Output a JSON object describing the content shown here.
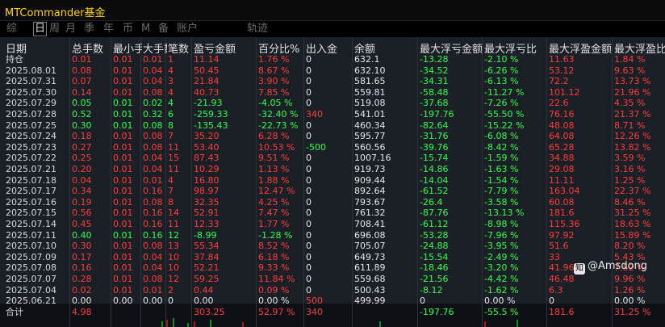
{
  "app": {
    "title": "MTCommander基金"
  },
  "tabs": [
    {
      "label": "综",
      "active": false
    },
    {
      "label": "日",
      "active": true
    },
    {
      "label": "周",
      "active": false
    },
    {
      "label": "月",
      "active": false
    },
    {
      "label": "季",
      "active": false
    },
    {
      "label": "年",
      "active": false
    },
    {
      "label": "币",
      "active": false
    },
    {
      "label": "M",
      "active": false
    },
    {
      "label": "备",
      "active": false
    },
    {
      "label": "账户",
      "active": false
    },
    {
      "label": "轨迹",
      "active": false
    }
  ],
  "table": {
    "headers": [
      "日期",
      "总手数",
      "最小手",
      "大手数",
      "笔数",
      "盈亏金额",
      "百分比%",
      "出入金",
      "余额",
      "最大浮亏金额",
      "最大浮亏比",
      "最大浮盈金额",
      "最大浮盈比"
    ],
    "rows": [
      {
        "date": "持仓",
        "lots": "0.01",
        "min": "0.01",
        "max": "0.01",
        "count": "1",
        "pnl": "11.14",
        "pct": "1.76 %",
        "io": "0",
        "bal": "632.1",
        "mfa": "-13.28",
        "mfp": "-2.10 %",
        "mga": "11.63",
        "mgp": "1.84 %",
        "c": "r",
        "ioc": "w"
      },
      {
        "date": "2025.08.01",
        "lots": "0.08",
        "min": "0.01",
        "max": "0.04",
        "count": "4",
        "pnl": "50.45",
        "pct": "8.67 %",
        "io": "0",
        "bal": "632.10",
        "mfa": "-34.52",
        "mfp": "-6.26 %",
        "mga": "53.12",
        "mgp": "9.63 %",
        "c": "r",
        "ioc": "w"
      },
      {
        "date": "2025.07.31",
        "lots": "0.07",
        "min": "0.01",
        "max": "0.04",
        "count": "3",
        "pnl": "21.84",
        "pct": "3.90 %",
        "io": "0",
        "bal": "581.65",
        "mfa": "-34.31",
        "mfp": "-6.13 %",
        "mga": "72.2",
        "mgp": "13.73 %",
        "c": "r",
        "ioc": "w"
      },
      {
        "date": "2025.07.30",
        "lots": "0.14",
        "min": "0.01",
        "max": "0.08",
        "count": "4",
        "pnl": "40.73",
        "pct": "7.85 %",
        "io": "0",
        "bal": "559.81",
        "mfa": "-58.48",
        "mfp": "-11.27 %",
        "mga": "101.12",
        "mgp": "21.96 %",
        "c": "r",
        "ioc": "w"
      },
      {
        "date": "2025.07.29",
        "lots": "0.05",
        "min": "0.01",
        "max": "0.02",
        "count": "4",
        "pnl": "-21.93",
        "pct": "-4.05 %",
        "io": "0",
        "bal": "519.08",
        "mfa": "-37.68",
        "mfp": "-7.26 %",
        "mga": "22.6",
        "mgp": "4.35 %",
        "c": "g",
        "ioc": "w"
      },
      {
        "date": "2025.07.28",
        "lots": "0.52",
        "min": "0.01",
        "max": "0.32",
        "count": "6",
        "pnl": "-259.33",
        "pct": "-32.40 %",
        "io": "340",
        "bal": "541.01",
        "mfa": "-197.76",
        "mfp": "-55.50 %",
        "mga": "76.16",
        "mgp": "21.37 %",
        "c": "g",
        "ioc": "r"
      },
      {
        "date": "2025.07.25",
        "lots": "0.30",
        "min": "0.01",
        "max": "0.08",
        "count": "8",
        "pnl": "-135.43",
        "pct": "-22.73 %",
        "io": "0",
        "bal": "460.34",
        "mfa": "-82.64",
        "mfp": "-15.22 %",
        "mga": "48.08",
        "mgp": "8.71 %",
        "c": "g",
        "ioc": "w"
      },
      {
        "date": "2025.07.24",
        "lots": "0.18",
        "min": "0.01",
        "max": "0.08",
        "count": "7",
        "pnl": "35.20",
        "pct": "6.28 %",
        "io": "0",
        "bal": "595.77",
        "mfa": "-31.76",
        "mfp": "-6.08 %",
        "mga": "64.08",
        "mgp": "12.26 %",
        "c": "r",
        "ioc": "w"
      },
      {
        "date": "2025.07.23",
        "lots": "0.27",
        "min": "0.01",
        "max": "0.08",
        "count": "11",
        "pnl": "53.40",
        "pct": "10.53 %",
        "io": "-500",
        "bal": "560.56",
        "mfa": "-39.76",
        "mfp": "-8.42 %",
        "mga": "65.28",
        "mgp": "13.82 %",
        "c": "r",
        "ioc": "g"
      },
      {
        "date": "2025.07.22",
        "lots": "0.25",
        "min": "0.01",
        "max": "0.04",
        "count": "15",
        "pnl": "87.43",
        "pct": "9.51 %",
        "io": "0",
        "bal": "1007.16",
        "mfa": "-15.74",
        "mfp": "-1.59 %",
        "mga": "34.88",
        "mgp": "3.59 %",
        "c": "r",
        "ioc": "w"
      },
      {
        "date": "2025.07.21",
        "lots": "0.20",
        "min": "0.01",
        "max": "0.04",
        "count": "11",
        "pnl": "10.29",
        "pct": "1.13 %",
        "io": "0",
        "bal": "919.73",
        "mfa": "-14.86",
        "mfp": "-1.63 %",
        "mga": "29.08",
        "mgp": "3.16 %",
        "c": "r",
        "ioc": "w"
      },
      {
        "date": "2025.07.18",
        "lots": "0.04",
        "min": "0.01",
        "max": "0.01",
        "count": "4",
        "pnl": "16.80",
        "pct": "1.88 %",
        "io": "0",
        "bal": "909.44",
        "mfa": "-14.04",
        "mfp": "-1.54 %",
        "mga": "11.11",
        "mgp": "1.25 %",
        "c": "r",
        "ioc": "w"
      },
      {
        "date": "2025.07.17",
        "lots": "0.34",
        "min": "0.01",
        "max": "0.16",
        "count": "7",
        "pnl": "98.97",
        "pct": "12.47 %",
        "io": "0",
        "bal": "892.64",
        "mfa": "-61.52",
        "mfp": "-7.79 %",
        "mga": "163.04",
        "mgp": "22.37 %",
        "c": "r",
        "ioc": "w"
      },
      {
        "date": "2025.07.16",
        "lots": "0.19",
        "min": "0.01",
        "max": "0.08",
        "count": "8",
        "pnl": "32.35",
        "pct": "4.25 %",
        "io": "0",
        "bal": "793.67",
        "mfa": "-26.4",
        "mfp": "-3.58 %",
        "mga": "60.08",
        "mgp": "8.46 %",
        "c": "r",
        "ioc": "w"
      },
      {
        "date": "2025.07.15",
        "lots": "0.56",
        "min": "0.01",
        "max": "0.16",
        "count": "14",
        "pnl": "52.91",
        "pct": "7.47 %",
        "io": "0",
        "bal": "761.32",
        "mfa": "-87.76",
        "mfp": "-13.13 %",
        "mga": "181.6",
        "mgp": "31.25 %",
        "c": "r",
        "ioc": "w"
      },
      {
        "date": "2025.07.14",
        "lots": "0.45",
        "min": "0.01",
        "max": "0.16",
        "count": "11",
        "pnl": "12.33",
        "pct": "1.77 %",
        "io": "0",
        "bal": "708.41",
        "mfa": "-61.12",
        "mfp": "-8.98 %",
        "mga": "115.36",
        "mgp": "18.63 %",
        "c": "r",
        "ioc": "w"
      },
      {
        "date": "2025.07.11",
        "lots": "0.40",
        "min": "0.01",
        "max": "0.16",
        "count": "12",
        "pnl": "-8.99",
        "pct": "-1.28 %",
        "io": "0",
        "bal": "696.08",
        "mfa": "-53.28",
        "mfp": "-7.96 %",
        "mga": "97.92",
        "mgp": "15.89 %",
        "c": "g",
        "ioc": "w"
      },
      {
        "date": "2025.07.10",
        "lots": "0.30",
        "min": "0.01",
        "max": "0.08",
        "count": "13",
        "pnl": "55.34",
        "pct": "8.52 %",
        "io": "0",
        "bal": "705.07",
        "mfa": "-24.88",
        "mfp": "-3.95 %",
        "mga": "51.6",
        "mgp": "8.20 %",
        "c": "r",
        "ioc": "w"
      },
      {
        "date": "2025.07.09",
        "lots": "0.17",
        "min": "0.01",
        "max": "0.04",
        "count": "10",
        "pnl": "37.84",
        "pct": "6.18 %",
        "io": "0",
        "bal": "649.73",
        "mfa": "-15.54",
        "mfp": "-2.49 %",
        "mga": "33",
        "mgp": "5.43 %",
        "c": "r",
        "ioc": "w"
      },
      {
        "date": "2025.07.08",
        "lots": "0.16",
        "min": "0.01",
        "max": "0.04",
        "count": "10",
        "pnl": "52.21",
        "pct": "9.33 %",
        "io": "0",
        "bal": "611.89",
        "mfa": "-18.46",
        "mfp": "-3.20 %",
        "mga": "41.96",
        "mgp": "7.52 %",
        "c": "r",
        "ioc": "w"
      },
      {
        "date": "2025.07.07",
        "lots": "0.28",
        "min": "0.01",
        "max": "0.08",
        "count": "12",
        "pnl": "59.25",
        "pct": "11.84 %",
        "io": "0",
        "bal": "559.68",
        "mfa": "-21.56",
        "mfp": "-4.42 %",
        "mga": "46.48",
        "mgp": "9.96 %",
        "c": "r",
        "ioc": "w"
      },
      {
        "date": "2025.07.04",
        "lots": "0.02",
        "min": "0.01",
        "max": "0.01",
        "count": "2",
        "pnl": "0.44",
        "pct": "0.09 %",
        "io": "0",
        "bal": "500.43",
        "mfa": "-8.12",
        "mfp": "-1.62 %",
        "mga": "6.3",
        "mgp": "1.26 %",
        "c": "r",
        "ioc": "w"
      },
      {
        "date": "2025.06.21",
        "lots": "0.00",
        "min": "0.00",
        "max": "0.00",
        "count": "0",
        "pnl": "0.00",
        "pct": "0.00 %",
        "io": "500",
        "bal": "499.99",
        "mfa": "0",
        "mfp": "0.00 %",
        "mga": "0",
        "mgp": "0.00 %",
        "c": "w",
        "ioc": "r"
      },
      {
        "date": "合计",
        "lots": "4.98",
        "min": "",
        "max": "",
        "count": "",
        "pnl": "303.25",
        "pct": "52.97 %",
        "io": "340",
        "bal": "",
        "mfa": "-197.76",
        "mfp": "-55.5 %",
        "mga": "181.6",
        "mgp": "31.25 %",
        "c": "r",
        "ioc": "r"
      }
    ]
  },
  "watermark": {
    "text": "@Amsdong",
    "icon": "zhihu-icon"
  }
}
